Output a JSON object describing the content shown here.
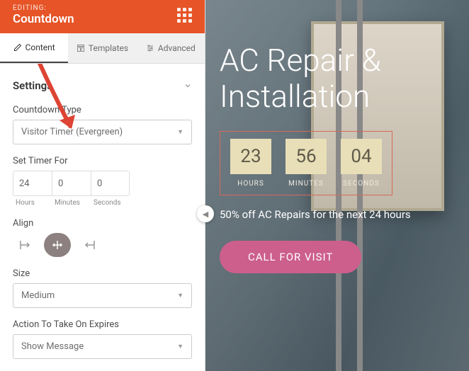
{
  "header": {
    "editing_label": "EDITING:",
    "title": "Countdown"
  },
  "tabs": {
    "content": "Content",
    "templates": "Templates",
    "advanced": "Advanced"
  },
  "settings": {
    "heading": "Settings",
    "countdown_type_label": "Countdown Type",
    "countdown_type_value": "Visitor Timer (Evergreen)",
    "set_timer_label": "Set Timer For",
    "hours": "24",
    "minutes": "0",
    "seconds": "0",
    "hours_label": "Hours",
    "minutes_label": "Minutes",
    "seconds_label": "Seconds",
    "align_label": "Align",
    "size_label": "Size",
    "size_value": "Medium",
    "action_label": "Action To Take On Expires",
    "action_value": "Show Message"
  },
  "preview": {
    "headline": "AC Repair & Installation",
    "cd_hours": "23",
    "cd_minutes": "56",
    "cd_seconds": "04",
    "lbl_hours": "HOURS",
    "lbl_minutes": "MINUTES",
    "lbl_seconds": "SECONDS",
    "promo": "50% off AC Repairs for the next 24 hours",
    "cta": "CALL FOR VISIT"
  }
}
